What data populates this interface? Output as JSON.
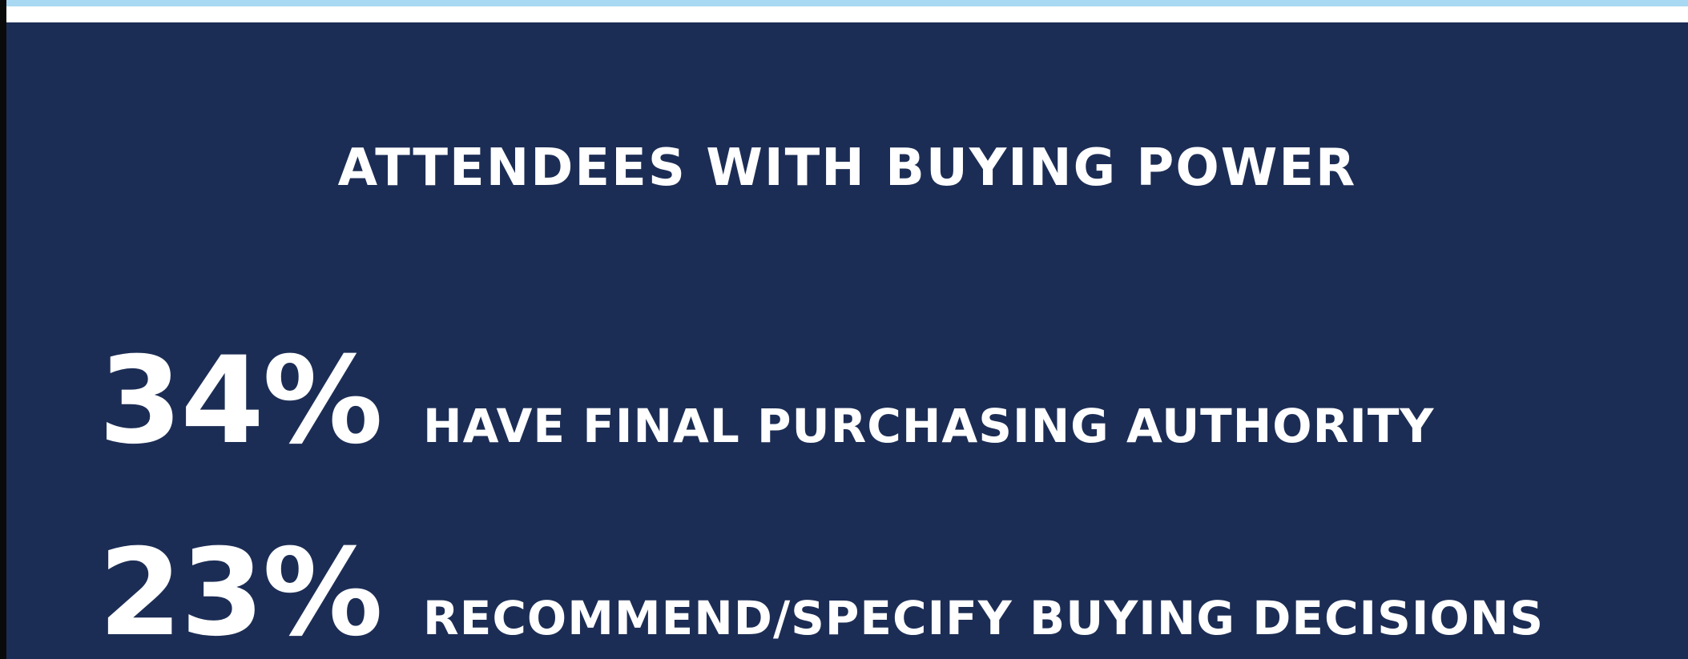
{
  "title": "ATTENDEES WITH BUYING POWER",
  "stats": [
    {
      "value": "34%",
      "label": "HAVE FINAL PURCHASING AUTHORITY"
    },
    {
      "value": "23%",
      "label": "RECOMMEND/SPECIFY BUYING DECISIONS"
    }
  ],
  "colors": {
    "panel_background": "#1c2d55",
    "text": "#ffffff",
    "top_accent": "#a9d8f2"
  }
}
